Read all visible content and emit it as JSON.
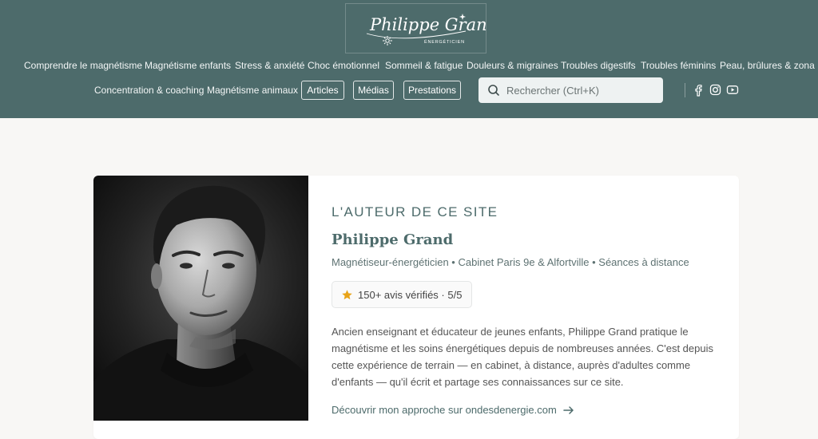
{
  "brand": {
    "logo_script": "Philippe Grand",
    "logo_tagline": "ÉNERGÉTICIEN"
  },
  "nav": {
    "row1": [
      "Comprendre le magnétisme",
      "Magnétisme enfants",
      "Stress & anxiété",
      "Choc émotionnel",
      "Sommeil & fatigue",
      "Douleurs & migraines",
      "Troubles digestifs",
      "Troubles féminins",
      "Peau, brûlures & zona"
    ],
    "row2_links": [
      "Concentration & coaching",
      "Magnétisme animaux"
    ],
    "row2_pills": [
      "Articles",
      "Médias",
      "Prestations"
    ]
  },
  "search": {
    "placeholder": "Rechercher (Ctrl+K)"
  },
  "social_icons": [
    "facebook-icon",
    "instagram-icon",
    "youtube-icon"
  ],
  "author": {
    "eyebrow": "L'AUTEUR DE CE SITE",
    "name": "Philippe Grand",
    "meta": "Magnétiseur-énergéticien • Cabinet Paris 9e & Alfortville • Séances à distance",
    "rating": "150+ avis vérifiés · 5/5",
    "bio": "Ancien enseignant et éducateur de jeunes enfants, Philippe Grand pratique le magnétisme et les soins énergétiques depuis de nombreuses années. C'est depuis cette expérience de terrain — en cabinet, à distance, auprès d'adultes comme d'enfants — qu'il écrit et partage ses connaissances sur ce site.",
    "link": "Découvrir mon approche sur ondesdenergie.com"
  },
  "colors": {
    "header_bg": "#4d6b6b",
    "accent": "#4d6b6b",
    "star": "#e8a317",
    "page_bg": "#f8f7f5"
  }
}
